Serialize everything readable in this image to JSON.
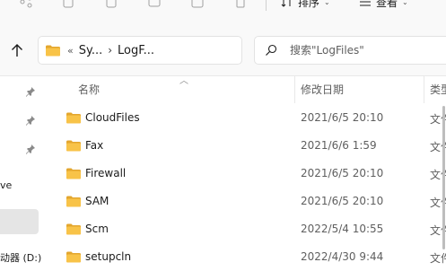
{
  "toolbar": {
    "sort_label": "排序",
    "view_label": "查看"
  },
  "address": {
    "prefix": "«",
    "crumbs": [
      "Sy...",
      "LogF..."
    ]
  },
  "search": {
    "placeholder": "搜索\"LogFiles\""
  },
  "nav": {
    "partial_item_1": "ve",
    "partial_item_2": "动器 (D:)"
  },
  "columns": {
    "name": "名称",
    "date": "修改日期",
    "type": "类型"
  },
  "files": [
    {
      "name": "CloudFiles",
      "date": "2021/6/5 20:10",
      "type": "文件"
    },
    {
      "name": "Fax",
      "date": "2021/6/6 1:59",
      "type": "文件"
    },
    {
      "name": "Firewall",
      "date": "2021/6/5 20:10",
      "type": "文件"
    },
    {
      "name": "SAM",
      "date": "2021/6/5 20:10",
      "type": "文件"
    },
    {
      "name": "Scm",
      "date": "2022/5/4 10:55",
      "type": "文件"
    },
    {
      "name": "setupcln",
      "date": "2022/4/30 9:44",
      "type": "文件"
    }
  ],
  "colors": {
    "folder_yellow": "#f8c348",
    "folder_dark": "#e3a62e",
    "chrome_bg": "#f9f9f9",
    "selected_bg": "#e5e5e5"
  }
}
